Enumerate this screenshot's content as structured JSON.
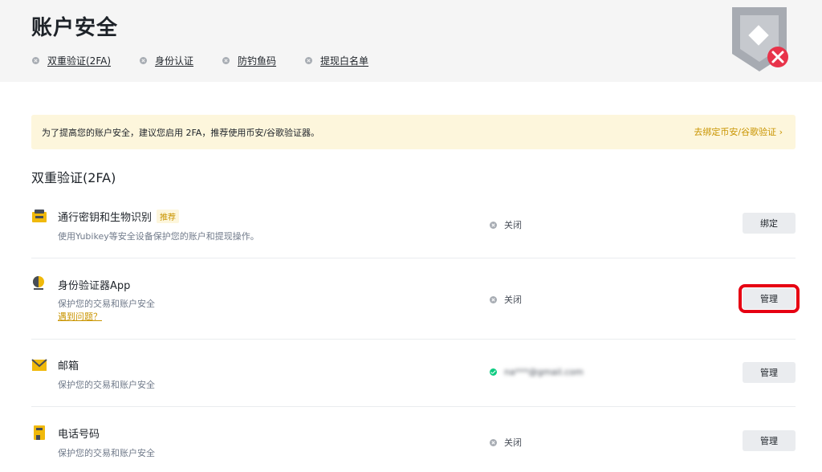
{
  "header": {
    "title": "账户安全",
    "links": [
      {
        "label": "双重验证(2FA)"
      },
      {
        "label": "身份认证"
      },
      {
        "label": "防钓鱼码"
      },
      {
        "label": "提现白名单"
      }
    ]
  },
  "banner": {
    "text": "为了提高您的账户安全，建议您启用 2FA，推荐使用币安/谷歌验证器。",
    "link": "去绑定币安/谷歌验证 ›"
  },
  "section": {
    "title": "双重验证(2FA)"
  },
  "rows": [
    {
      "title": "通行密钥和生物识别",
      "badge": "推荐",
      "desc": "使用Yubikey等安全设备保护您的账户和提现操作。",
      "status": "关闭",
      "button": "绑定",
      "icon": "passkey-icon"
    },
    {
      "title": "身份验证器App",
      "desc": "保护您的交易和账户安全",
      "help_link": "遇到问题？",
      "status": "关闭",
      "button": "管理",
      "icon": "authenticator-icon"
    },
    {
      "title": "邮箱",
      "desc": "保护您的交易和账户安全",
      "status": "na***@gmail.com",
      "button": "管理",
      "icon": "envelope-icon"
    },
    {
      "title": "电话号码",
      "desc": "保护您的交易和账户安全",
      "status": "关闭",
      "button": "管理",
      "icon": "phone-icon"
    }
  ],
  "colors": {
    "accent": "#c99400",
    "highlight": "#e60012",
    "banner_bg": "#fdf6dc",
    "header_bg": "#f5f5f5",
    "ok": "#0ecb81"
  }
}
